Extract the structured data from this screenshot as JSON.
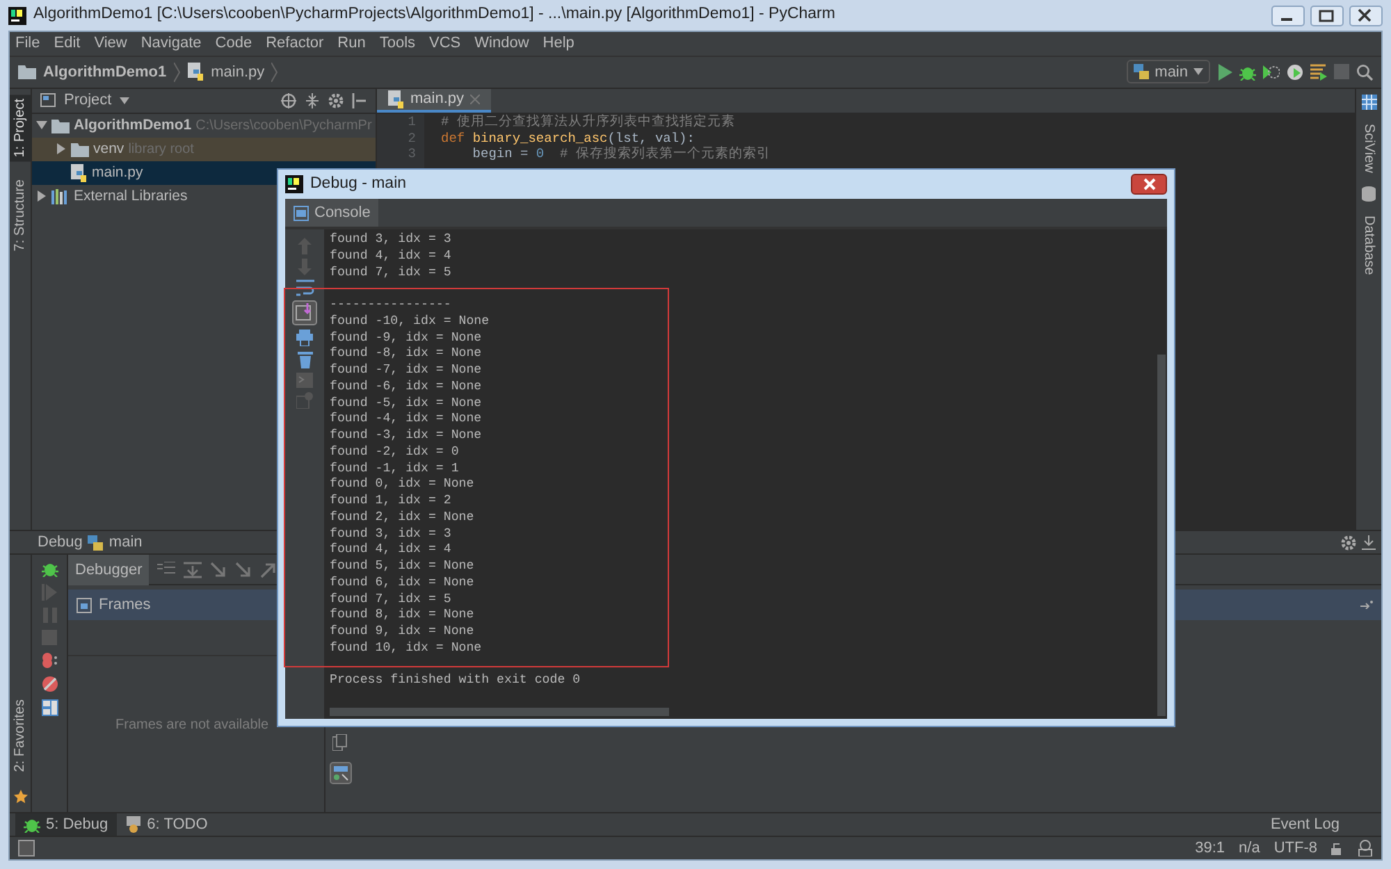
{
  "window": {
    "title": "AlgorithmDemo1 [C:\\Users\\cooben\\PycharmProjects\\AlgorithmDemo1] - ...\\main.py [AlgorithmDemo1] - PyCharm"
  },
  "menu": [
    "File",
    "Edit",
    "View",
    "Navigate",
    "Code",
    "Refactor",
    "Run",
    "Tools",
    "VCS",
    "Window",
    "Help"
  ],
  "breadcrumbs": [
    "AlgorithmDemo1",
    "main.py"
  ],
  "run_config": "main",
  "left_tools": [
    {
      "label": "1: Project",
      "selected": true
    },
    {
      "label": "7: Structure",
      "selected": false
    }
  ],
  "favorites": "2: Favorites",
  "right_tools": [
    "SciView",
    "Database"
  ],
  "project": {
    "title": "Project",
    "tree": [
      {
        "label": "AlgorithmDemo1",
        "hint": "C:\\Users\\cooben\\PycharmPr",
        "kind": "folder",
        "expanded": true,
        "selected": false,
        "children": [
          {
            "label": "venv",
            "hint": "library root",
            "kind": "venv",
            "expanded": false,
            "selected": false
          },
          {
            "label": "main.py",
            "kind": "python",
            "selected": true
          }
        ]
      },
      {
        "label": "External Libraries",
        "kind": "library",
        "expanded": false,
        "selected": false
      }
    ]
  },
  "editor": {
    "tabs": [
      {
        "label": "main.py",
        "selected": true
      }
    ],
    "lines": [
      {
        "number": "1",
        "tokens": [
          {
            "text": "# 使用二分查找算法从升序列表中查找指定元素",
            "kind": "comment"
          }
        ]
      },
      {
        "number": "2",
        "tokens": [
          {
            "text": "def ",
            "kind": "keyword"
          },
          {
            "text": "binary_search_asc",
            "kind": "function"
          },
          {
            "text": "(lst, val):",
            "kind": "plain"
          }
        ]
      },
      {
        "number": "3",
        "tokens": [
          {
            "text": "    begin = ",
            "kind": "plain"
          },
          {
            "text": "0",
            "kind": "number"
          },
          {
            "text": "  # 保存搜索列表第一个元素的索引",
            "kind": "comment"
          }
        ]
      }
    ]
  },
  "debug_panel": {
    "title": "Debug",
    "config": "main",
    "tabs": [
      {
        "label": "Debugger",
        "selected": true
      }
    ],
    "frames_header": "Frames",
    "empty_text": "Frames are not available"
  },
  "tool_bar": [
    {
      "label": "5: Debug",
      "selected": true
    },
    {
      "label": "6: TODO",
      "selected": false
    }
  ],
  "event_log": "Event Log",
  "status": [
    "39:1",
    "n/a",
    "UTF-8"
  ],
  "dialog": {
    "title": "Debug - main",
    "tabs": [
      {
        "label": "Console",
        "selected": true
      }
    ],
    "output": [
      "found 3, idx = 3",
      "found 4, idx = 4",
      "found 7, idx = 5"
    ],
    "highlighted_output": [
      "----------------",
      "found -10, idx = None",
      "found -9, idx = None",
      "found -8, idx = None",
      "found -7, idx = None",
      "found -6, idx = None",
      "found -5, idx = None",
      "found -4, idx = None",
      "found -3, idx = None",
      "found -2, idx = 0",
      "found -1, idx = 1",
      "found 0, idx = None",
      "found 1, idx = 2",
      "found 2, idx = None",
      "found 3, idx = 3",
      "found 4, idx = 4",
      "found 5, idx = None",
      "found 6, idx = None",
      "found 7, idx = 5",
      "found 8, idx = None",
      "found 9, idx = None",
      "found 10, idx = None"
    ],
    "footer": "Process finished with exit code 0"
  }
}
